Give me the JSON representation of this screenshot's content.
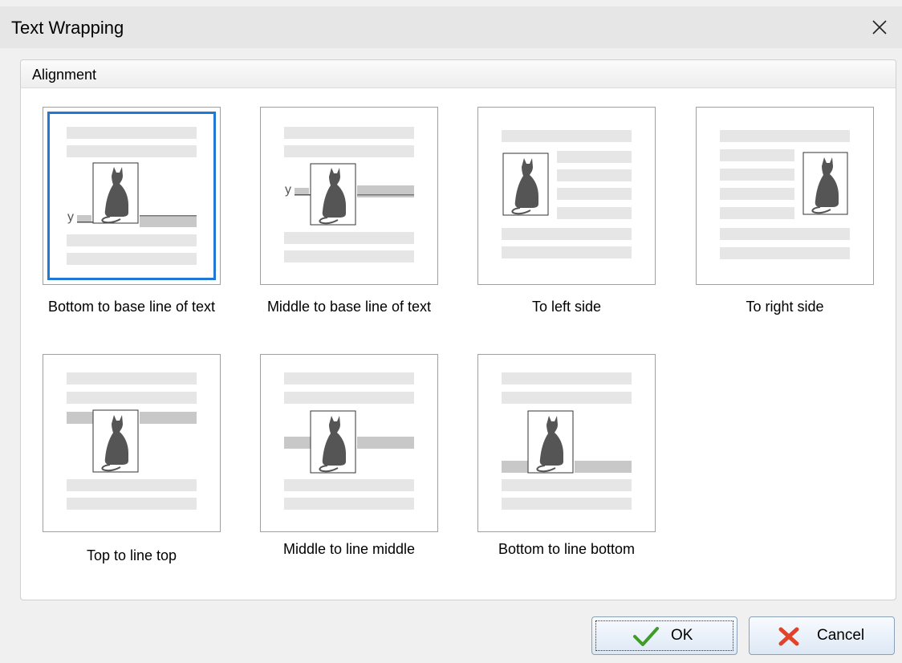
{
  "window": {
    "title": "Text Wrapping"
  },
  "group": {
    "label": "Alignment"
  },
  "options": [
    {
      "label": "Bottom to base line of text",
      "selected": true
    },
    {
      "label": "Middle to base line of text",
      "selected": false
    },
    {
      "label": "To left side",
      "selected": false
    },
    {
      "label": "To right side",
      "selected": false
    },
    {
      "label": "Top to line top",
      "selected": false
    },
    {
      "label": "Middle to line middle",
      "selected": false
    },
    {
      "label": "Bottom to line bottom",
      "selected": false
    }
  ],
  "sample_glyph": "y",
  "buttons": {
    "ok": "OK",
    "cancel": "Cancel"
  },
  "icons": {
    "close": "close-icon",
    "ok": "checkmark-icon",
    "cancel": "red-x-icon",
    "preview": "cat-picture-icon"
  },
  "colors": {
    "selection": "#1f78d1",
    "text_line": "#e6e6e6",
    "base_line": "#c8c8c8",
    "picture": "#555555"
  }
}
